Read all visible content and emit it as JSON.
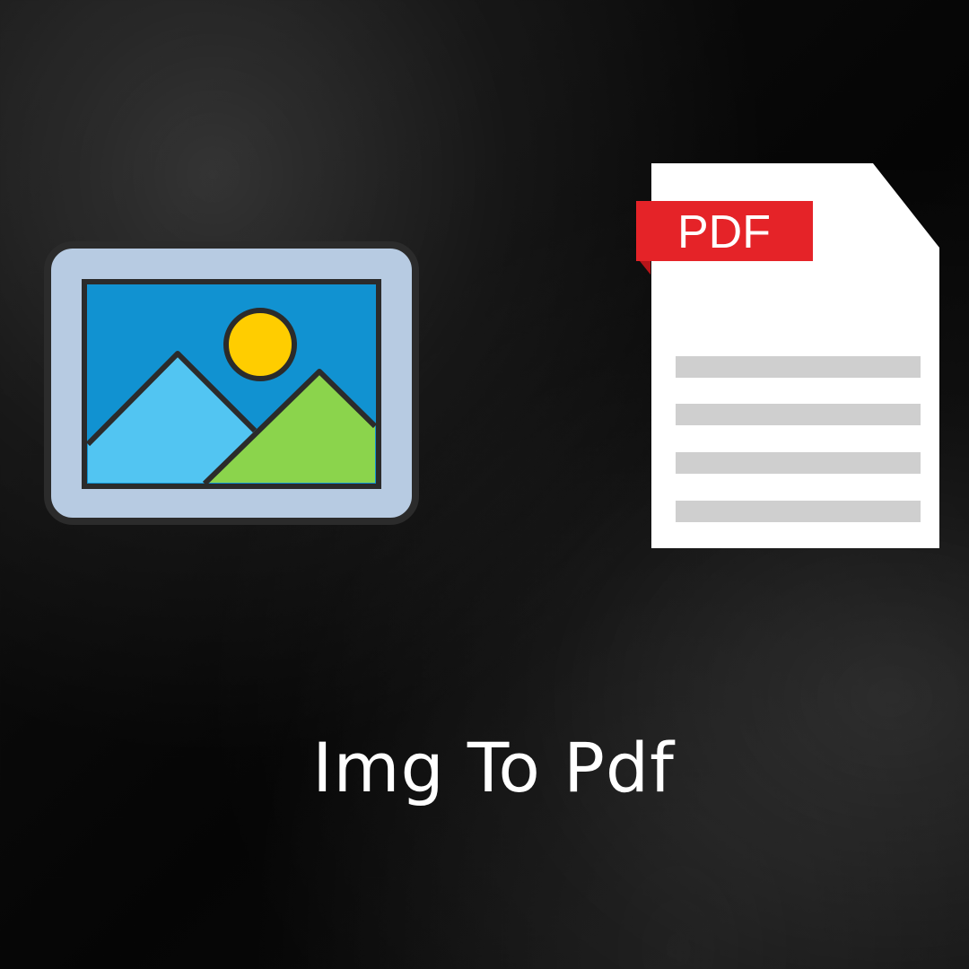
{
  "icons": {
    "image": "image-icon",
    "pdf": "pdf-file-icon"
  },
  "pdf_badge": {
    "label": "PDF"
  },
  "title": "Img To Pdf",
  "colors": {
    "frame": "#b7cbe2",
    "frame_outline": "#2b2b2b",
    "sky": "#1192d1",
    "sun": "#ffcd00",
    "mountain_left": "#52c5f2",
    "mountain_right": "#8bd44c",
    "paper": "#ffffff",
    "pdf_red": "#e52328",
    "pdf_red_dark": "#b8151a",
    "text_lines": "#cfcfcf"
  }
}
